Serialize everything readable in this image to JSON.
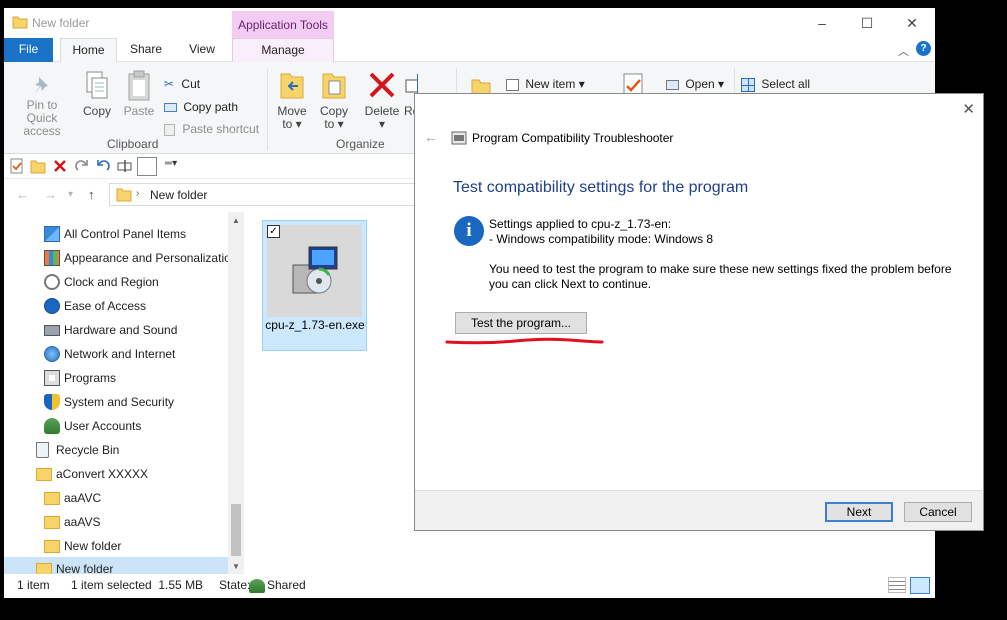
{
  "explorer": {
    "title": "New folder",
    "contextual_tab": "Application Tools",
    "tabs": {
      "file": "File",
      "home": "Home",
      "share": "Share",
      "view": "View",
      "manage": "Manage"
    },
    "window_buttons": {
      "minimize": "–",
      "maximize": "☐",
      "close": "✕"
    },
    "help_glyph": "?",
    "ribbon": {
      "clipboard": {
        "pin_label_1": "Pin to Quick",
        "pin_label_2": "access",
        "copy": "Copy",
        "paste": "Paste",
        "cut": "Cut",
        "copy_path": "Copy path",
        "paste_shortcut": "Paste shortcut",
        "group": "Clipboard"
      },
      "organize": {
        "move_to_1": "Move",
        "move_to_2": "to",
        "copy_to_1": "Copy",
        "copy_to_2": "to",
        "delete": "Delete",
        "rename_partial": "Re",
        "group": "Organize"
      },
      "new": {
        "new_item": "New item"
      },
      "open": {
        "open": "Open"
      },
      "select": {
        "select_all": "Select all"
      }
    },
    "address": {
      "crumb": "New folder"
    },
    "nav": {
      "items": [
        {
          "label": "All Control Panel Items",
          "icon": "control-panel-icon"
        },
        {
          "label": "Appearance and Personalizatio",
          "icon": "appearance-icon"
        },
        {
          "label": "Clock and Region",
          "icon": "clock-icon"
        },
        {
          "label": "Ease of Access",
          "icon": "ease-of-access-icon"
        },
        {
          "label": "Hardware and Sound",
          "icon": "printer-icon"
        },
        {
          "label": "Network and Internet",
          "icon": "network-icon"
        },
        {
          "label": "Programs",
          "icon": "programs-icon"
        },
        {
          "label": "System and Security",
          "icon": "shield-icon"
        },
        {
          "label": "User Accounts",
          "icon": "users-icon"
        },
        {
          "label": "Recycle Bin",
          "icon": "recycle-bin-icon"
        },
        {
          "label": "aConvert XXXXX",
          "icon": "folder-icon"
        },
        {
          "label": "aaAVC",
          "icon": "folder-icon"
        },
        {
          "label": "aaAVS",
          "icon": "folder-icon"
        },
        {
          "label": "New folder",
          "icon": "folder-icon"
        },
        {
          "label": "New folder",
          "icon": "folder-icon",
          "selected": true
        }
      ]
    },
    "file": {
      "name": "cpu-z_1.73-en.exe"
    },
    "status": {
      "count": "1 item",
      "selected": "1 item selected  1.55 MB",
      "state_label": "State:",
      "state_value": "Shared"
    }
  },
  "dialog": {
    "window_title": "Program Compatibility Troubleshooter",
    "heading": "Test compatibility settings for the program",
    "applied_line_1": "Settings applied to cpu-z_1.73-en:",
    "applied_line_2": "- Windows compatibility mode: Windows 8",
    "instruction_1": "You need to test the program to make sure these new settings fixed the problem before",
    "instruction_2": "you can click Next to continue.",
    "test_button": "Test the program...",
    "next_button": "Next",
    "cancel_button": "Cancel",
    "close_glyph": "✕",
    "back_glyph": "←",
    "info_glyph": "i"
  },
  "colors": {
    "accent": "#1a73c8",
    "heading": "#1e3f8f",
    "annotation_red": "#e0101e",
    "selection": "#cce8ff"
  }
}
